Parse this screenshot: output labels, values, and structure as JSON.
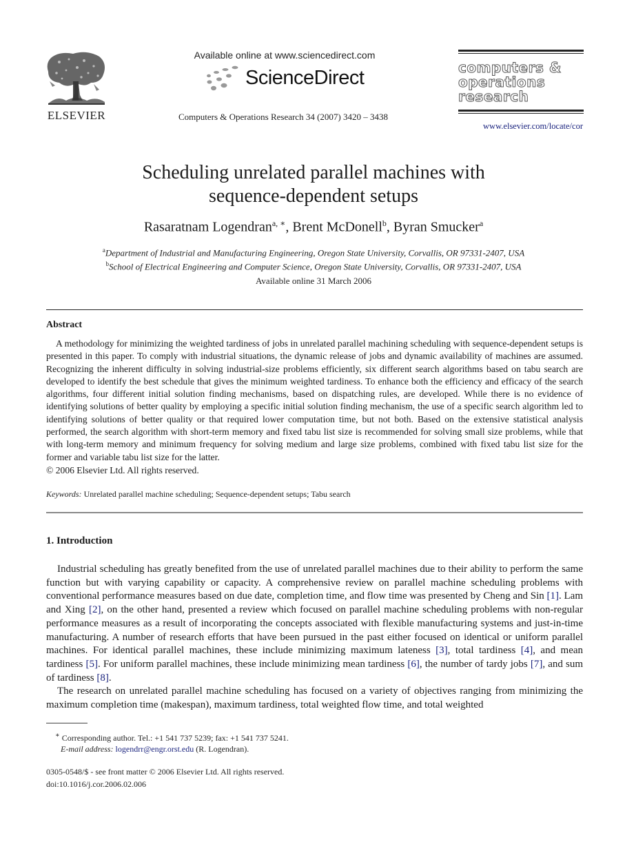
{
  "header": {
    "publisher_logo_text": "ELSEVIER",
    "sd_available": "Available online at www.sciencedirect.com",
    "sd_logo_text": "ScienceDirect",
    "journal_reference": "Computers & Operations Research 34 (2007) 3420 – 3438",
    "journal_logo_lines": [
      "computers &",
      "operations",
      "research"
    ],
    "journal_url": "www.elsevier.com/locate/cor"
  },
  "article": {
    "title_line1": "Scheduling unrelated parallel machines with",
    "title_line2": "sequence-dependent setups",
    "authors": [
      {
        "name": "Rasaratnam Logendran",
        "sup": "a, ∗",
        "sep": ", "
      },
      {
        "name": "Brent McDonell",
        "sup": "b",
        "sep": ", "
      },
      {
        "name": "Byran Smucker",
        "sup": "a",
        "sep": ""
      }
    ],
    "affiliations": [
      {
        "sup": "a",
        "text": "Department of Industrial and Manufacturing Engineering, Oregon State University, Corvallis, OR 97331-2407, USA"
      },
      {
        "sup": "b",
        "text": "School of Electrical Engineering and Computer Science, Oregon State University, Corvallis, OR 97331-2407, USA"
      }
    ],
    "available_online": "Available online 31 March 2006"
  },
  "abstract": {
    "heading": "Abstract",
    "body": "A methodology for minimizing the weighted tardiness of jobs in unrelated parallel machining scheduling with sequence-dependent setups is presented in this paper. To comply with industrial situations, the dynamic release of jobs and dynamic availability of machines are assumed. Recognizing the inherent difficulty in solving industrial-size problems efficiently, six different search algorithms based on tabu search are developed to identify the best schedule that gives the minimum weighted tardiness. To enhance both the efficiency and efficacy of the search algorithms, four different initial solution finding mechanisms, based on dispatching rules, are developed. While there is no evidence of identifying solutions of better quality by employing a specific initial solution finding mechanism, the use of a specific search algorithm led to identifying solutions of better quality or that required lower computation time, but not both. Based on the extensive statistical analysis performed, the search algorithm with short-term memory and fixed tabu list size is recommended for solving small size problems, while that with long-term memory and minimum frequency for solving medium and large size problems, combined with fixed tabu list size for the former and variable tabu list size for the latter.",
    "copyright": "© 2006 Elsevier Ltd. All rights reserved.",
    "keywords_label": "Keywords:",
    "keywords": "Unrelated parallel machine scheduling; Sequence-dependent setups; Tabu search"
  },
  "introduction": {
    "heading": "1.  Introduction",
    "p1": [
      {
        "t": "Industrial scheduling has greatly benefited from the use of unrelated parallel machines due to their ability to perform the same function but with varying capability or capacity. A comprehensive review on parallel machine scheduling problems with conventional performance measures based on due date, completion time, and flow time was presented by Cheng and Sin "
      },
      {
        "c": "[1]"
      },
      {
        "t": ". Lam and Xing "
      },
      {
        "c": "[2]"
      },
      {
        "t": ", on the other hand, presented a review which focused on parallel machine scheduling problems with non-regular performance measures as a result of incorporating the concepts associated with flexible manufacturing systems and just-in-time manufacturing. A number of research efforts that have been pursued in the past either focused on identical or uniform parallel machines. For identical parallel machines, these include minimizing maximum lateness "
      },
      {
        "c": "[3]"
      },
      {
        "t": ", total tardiness "
      },
      {
        "c": "[4]"
      },
      {
        "t": ", and mean tardiness "
      },
      {
        "c": "[5]"
      },
      {
        "t": ". For uniform parallel machines, these include minimizing mean tardiness "
      },
      {
        "c": "[6]"
      },
      {
        "t": ", the number of tardy jobs "
      },
      {
        "c": "[7]"
      },
      {
        "t": ", and sum of tardiness "
      },
      {
        "c": "[8]"
      },
      {
        "t": "."
      }
    ],
    "p2": "The research on unrelated parallel machine scheduling has focused on a variety of objectives ranging from minimizing the maximum completion time (makespan), maximum tardiness, total weighted flow time, and total weighted"
  },
  "footnotes": {
    "corresponding_mark": "∗",
    "corresponding": "Corresponding author. Tel.: +1 541 737 5239; fax: +1 541 737 5241.",
    "email_label": "E-mail address:",
    "email": "logendrr@engr.orst.edu",
    "email_owner": "(R. Logendran).",
    "front_matter": "0305-0548/$ - see front matter © 2006 Elsevier Ltd. All rights reserved.",
    "doi": "doi:10.1016/j.cor.2006.02.006"
  },
  "colors": {
    "link": "#1a237e",
    "text": "#1a1a1a",
    "rule_gray": "#888888"
  }
}
